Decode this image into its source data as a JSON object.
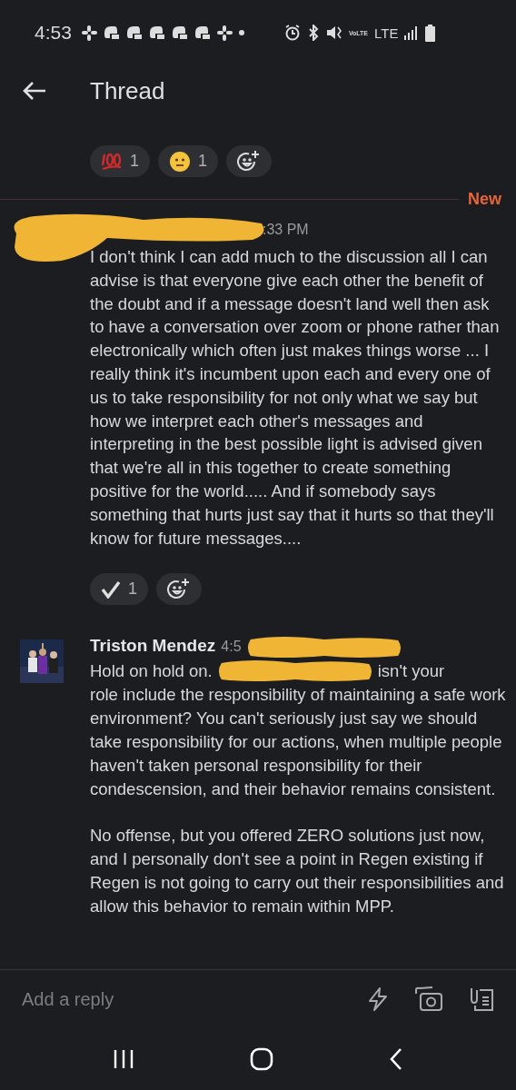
{
  "status_bar": {
    "time": "4:53",
    "volte": "VoLTE",
    "network": "LTE"
  },
  "header": {
    "title": "Thread"
  },
  "top_reactions": [
    {
      "kind": "hundred",
      "count": "1"
    },
    {
      "kind": "neutral",
      "count": "1"
    },
    {
      "kind": "add"
    }
  ],
  "new_divider": {
    "label": "New"
  },
  "messages": [
    {
      "author_hidden": true,
      "time": ":33 PM",
      "paragraphs": [
        {
          "before": "I don't think I can add much to the discussion all I can advise is that everyone give each other the benefit of the doubt and if a message doesn't land well then ask to have a conversation over zoom or phone rather than electronically which often just makes things worse ... I really think it's incumbent upon each and every one of us to take responsibility for not only what we say but how we interpret each other's messages and interpreting in the best possible light is advised given that we're all in this together to create something positive for the world..... And if somebody says something that hurts just say that it hurts so that they'll know for future messages...."
        }
      ],
      "reactions": [
        {
          "kind": "check",
          "count": "1"
        },
        {
          "kind": "add"
        }
      ]
    },
    {
      "author_hidden": false,
      "author": "Triston Mendez",
      "time": "4:5",
      "paragraphs": [
        {
          "before": "Hold on hold on.",
          "redacted": true,
          "after": "isn't your",
          "rest": "role include the responsibility of maintaining a safe work environment? You can't seriously just say we should take responsibility for our actions, when multiple people haven't taken personal responsibility for their condescension, and their behavior remains consistent."
        },
        {
          "before": "No offense, but you offered ZERO solutions just now, and I personally don't see a point in Regen existing if Regen is not going to carry out their responsibilities and allow this behavior to remain within MPP."
        }
      ]
    }
  ],
  "composer": {
    "placeholder": "Add a reply"
  }
}
